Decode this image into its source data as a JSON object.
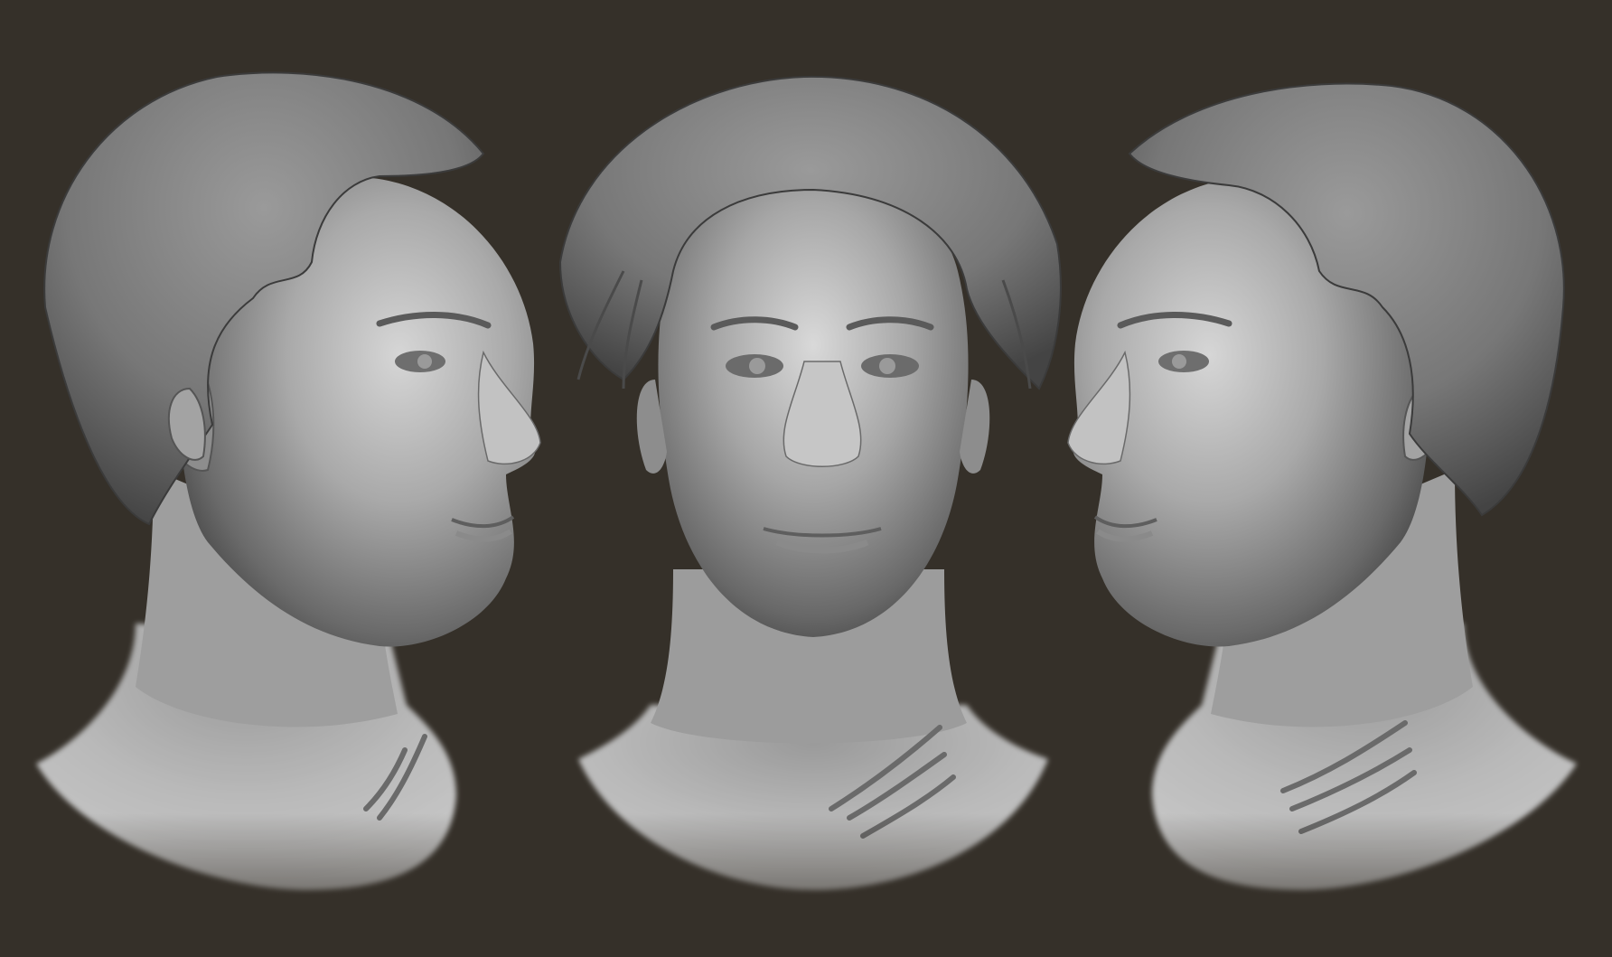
{
  "scene": {
    "background_color": "#353029",
    "clay_light": "#dcdcdc",
    "clay_mid": "#8a8a8a",
    "clay_dark": "#3e3e3e",
    "hair_color": "#7a7a7a",
    "hair_stroke": "#3a3a3a",
    "views": [
      {
        "view": "three-quarter-left"
      },
      {
        "view": "front"
      },
      {
        "view": "three-quarter-right"
      }
    ]
  }
}
